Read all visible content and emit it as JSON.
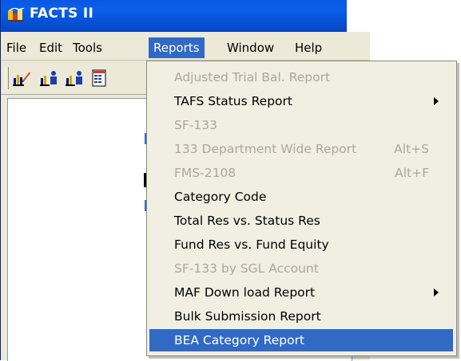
{
  "window": {
    "title": "FACTS II"
  },
  "menubar": {
    "items": [
      {
        "label": "File",
        "active": false
      },
      {
        "label": "Edit",
        "active": false
      },
      {
        "label": "Tools",
        "active": false
      },
      {
        "label": "Reports",
        "active": true
      },
      {
        "label": "Window",
        "active": false
      },
      {
        "label": "Help",
        "active": false
      }
    ]
  },
  "toolbar": {
    "icons": [
      "edit-chart-icon",
      "chart-user-icon",
      "chart-user-icon-2",
      "grid-report-icon"
    ]
  },
  "reports_menu": {
    "items": [
      {
        "label": "Adjusted Trial Bal. Report",
        "shortcut": "",
        "enabled": false,
        "submenu": false,
        "highlighted": false
      },
      {
        "label": "TAFS Status Report",
        "shortcut": "",
        "enabled": true,
        "submenu": true,
        "highlighted": false
      },
      {
        "label": "SF-133",
        "shortcut": "",
        "enabled": false,
        "submenu": false,
        "highlighted": false
      },
      {
        "label": "133 Department Wide Report",
        "shortcut": "Alt+S",
        "enabled": false,
        "submenu": false,
        "highlighted": false
      },
      {
        "label": "FMS-2108",
        "shortcut": "Alt+F",
        "enabled": false,
        "submenu": false,
        "highlighted": false
      },
      {
        "label": "Category Code",
        "shortcut": "",
        "enabled": true,
        "submenu": false,
        "highlighted": false
      },
      {
        "label": "Total Res vs. Status Res",
        "shortcut": "",
        "enabled": true,
        "submenu": false,
        "highlighted": false
      },
      {
        "label": "Fund Res vs. Fund Equity",
        "shortcut": "",
        "enabled": true,
        "submenu": false,
        "highlighted": false
      },
      {
        "label": "SF-133 by SGL Account",
        "shortcut": "",
        "enabled": false,
        "submenu": false,
        "highlighted": false
      },
      {
        "label": "MAF Down load Report",
        "shortcut": "",
        "enabled": true,
        "submenu": true,
        "highlighted": false
      },
      {
        "label": "Bulk Submission Report",
        "shortcut": "",
        "enabled": true,
        "submenu": false,
        "highlighted": false
      },
      {
        "label": "BEA Category Report",
        "shortcut": "",
        "enabled": true,
        "submenu": false,
        "highlighted": true
      }
    ]
  },
  "colors": {
    "titlebar": "#0a58e4",
    "highlight": "#316ac5",
    "disabled_text": "#aca899",
    "menu_bg": "#f1efe2"
  }
}
